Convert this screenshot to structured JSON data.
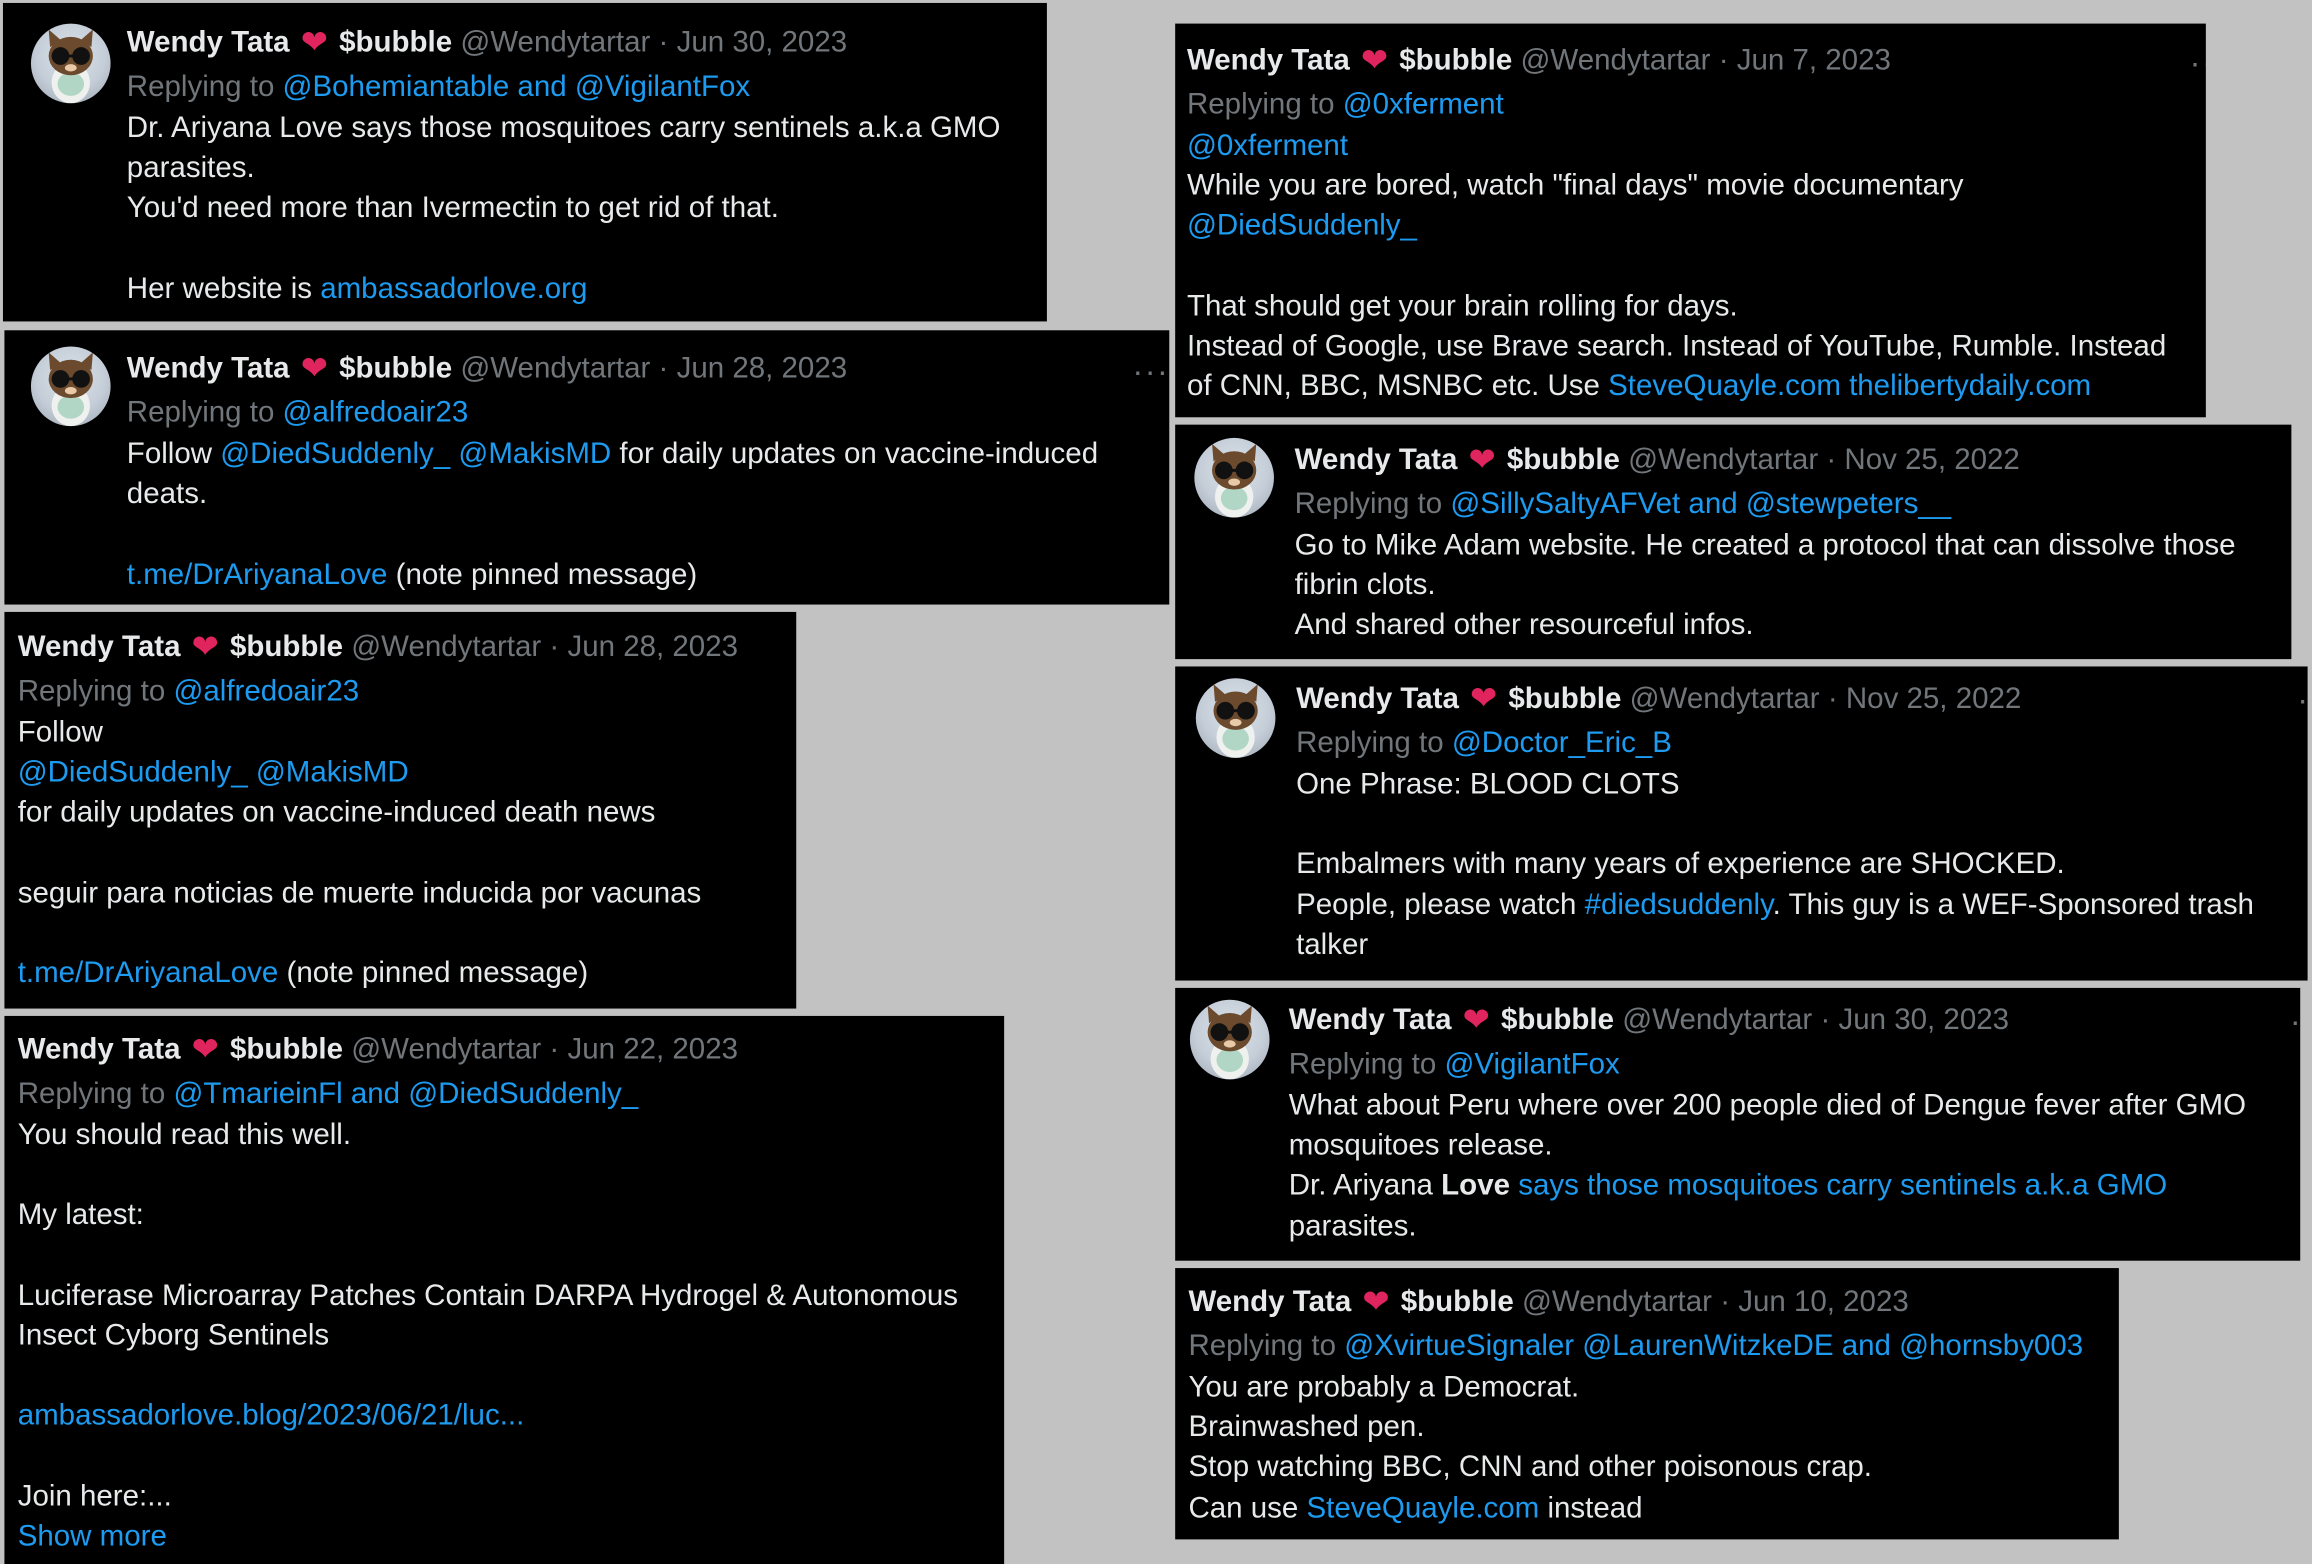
{
  "author": {
    "name": "Wendy Tata",
    "heart": "❤",
    "suffix": "$bubble",
    "handle": "@Wendytartar",
    "sep": "·"
  },
  "ui": {
    "replying_prefix": "Replying to",
    "more_icon": "more-dots-icon",
    "show_more": "Show more"
  },
  "tweets": [
    {
      "date": "Jun 30, 2023",
      "replying_to": "@Bohemiantable and @VigilantFox",
      "lines": [
        [
          "Dr. Ariyana Love says those mosquitoes carry sentinels a.k.a GMO"
        ],
        [
          "parasites."
        ],
        [
          "You'd need more than Ivermectin to get rid of that."
        ],
        [],
        [
          "Her website is ",
          "ambassadorlove.org"
        ]
      ]
    },
    {
      "date": "Jun 28, 2023",
      "replying_to": "@alfredoair23",
      "lines": [
        [
          "Follow ",
          "@DiedSuddenly_ @MakisMD",
          " for daily updates on vaccine-induced"
        ],
        [
          "deats."
        ],
        [],
        [
          "",
          "t.me/DrAriyanaLove",
          " (note pinned message)"
        ]
      ]
    },
    {
      "date": "Jun 28, 2023",
      "replying_to": "@alfredoair23",
      "lines": [
        [
          "Follow"
        ],
        [
          "",
          "@DiedSuddenly_ @MakisMD"
        ],
        [
          "for daily updates on vaccine-induced death news"
        ],
        [],
        [
          "seguir para noticias de muerte inducida por vacunas"
        ],
        [],
        [
          "",
          "t.me/DrAriyanaLove",
          " (note pinned message)"
        ]
      ]
    },
    {
      "date": "Jun 22, 2023",
      "replying_to": "@TmarieinFl and @DiedSuddenly_",
      "lines": [
        [
          "You should read this well."
        ],
        [],
        [
          "My latest:"
        ],
        [],
        [
          "Luciferase Microarray Patches Contain DARPA Hydrogel & Autonomous"
        ],
        [
          "Insect Cyborg Sentinels"
        ],
        [],
        [
          "",
          "ambassadorlove.blog/2023/06/21/luc..."
        ],
        [],
        [
          "Join here:..."
        ]
      ]
    },
    {
      "date": "Jun 7, 2023",
      "replying_to": "@0xferment",
      "lines": [
        [
          "",
          "@0xferment"
        ],
        [
          "While you are bored, watch \"final days\"  movie documentary"
        ],
        [
          "",
          "@DiedSuddenly_"
        ],
        [],
        [
          "That should get your brain rolling for days."
        ],
        [
          "Instead of Google, use Brave search. Instead of YouTube, Rumble. Instead"
        ],
        [
          "of CNN, BBC, MSNBC etc. Use ",
          "SteveQuayle.com thelibertydaily.com"
        ]
      ]
    },
    {
      "date": "Nov 25, 2022",
      "replying_to": "@SillySaltyAFVet and @stewpeters__",
      "lines": [
        [
          "Go to Mike Adam website. He created a protocol that can dissolve those"
        ],
        [
          "fibrin clots."
        ],
        [
          "And shared other resourceful infos."
        ]
      ]
    },
    {
      "date": "Nov 25, 2022",
      "replying_to": "@Doctor_Eric_B",
      "lines": [
        [
          "One Phrase: BLOOD CLOTS"
        ],
        [],
        [
          "Embalmers with many years of experience are SHOCKED."
        ],
        [
          "People, please watch ",
          "#diedsuddenly",
          ". This guy is a WEF-Sponsored trash"
        ],
        [
          "talker"
        ]
      ]
    },
    {
      "date": "Jun 30, 2023",
      "replying_to": "@VigilantFox",
      "lines": [
        [
          "What about Peru where over 200 people died of Dengue fever after GMO"
        ],
        [
          "mosquitoes release."
        ],
        [
          "Dr. Ariyana ",
          "",
          "Love",
          " says those mosquitoes carry sentinels a.k.a GMO"
        ],
        [
          "parasites."
        ]
      ]
    },
    {
      "date": "Jun 10, 2023",
      "replying_to": "@XvirtueSignaler @LaurenWitzkeDE and @hornsby003",
      "lines": [
        [
          "You are probably a Democrat."
        ],
        [
          "Brainwashed pen."
        ],
        [
          "Stop watching BBC, CNN and other poisonous crap."
        ],
        [
          "Can use ",
          "SteveQuayle.com",
          " instead"
        ]
      ]
    }
  ]
}
